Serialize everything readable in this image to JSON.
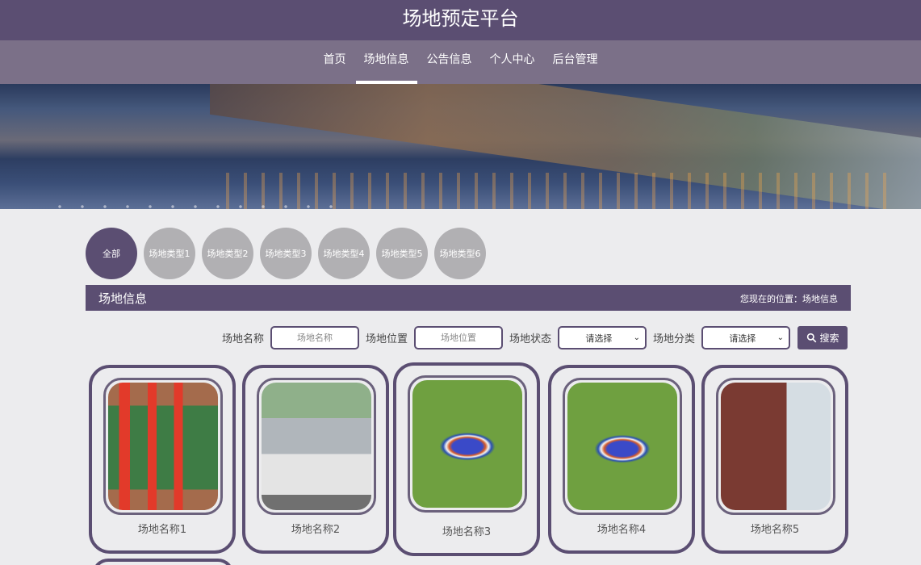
{
  "header": {
    "title": "场地预定平台"
  },
  "nav": [
    {
      "label": "首页"
    },
    {
      "label": "场地信息"
    },
    {
      "label": "公告信息"
    },
    {
      "label": "个人中心"
    },
    {
      "label": "后台管理"
    }
  ],
  "active_nav": "场地信息",
  "categories": [
    {
      "label": "全部"
    },
    {
      "label": "场地类型1"
    },
    {
      "label": "场地类型2"
    },
    {
      "label": "场地类型3"
    },
    {
      "label": "场地类型4"
    },
    {
      "label": "场地类型5"
    },
    {
      "label": "场地类型6"
    }
  ],
  "section": {
    "title": "场地信息",
    "breadcrumb": "您现在的位置：场地信息"
  },
  "filters": {
    "name_label": "场地名称",
    "name_placeholder": "场地名称",
    "location_label": "场地位置",
    "location_placeholder": "场地位置",
    "status_label": "场地状态",
    "status_value": "请选择",
    "category_label": "场地分类",
    "category_value": "请选择",
    "search_label": "搜索"
  },
  "venues": [
    {
      "name": "场地名称1"
    },
    {
      "name": "场地名称2"
    },
    {
      "name": "场地名称3"
    },
    {
      "name": "场地名称4"
    },
    {
      "name": "场地名称5"
    }
  ],
  "colors": {
    "brand": "#5b4e72",
    "nav_bg": "#7b7088",
    "page_bg": "#ececee",
    "category_inactive": "#b1b0b3"
  }
}
